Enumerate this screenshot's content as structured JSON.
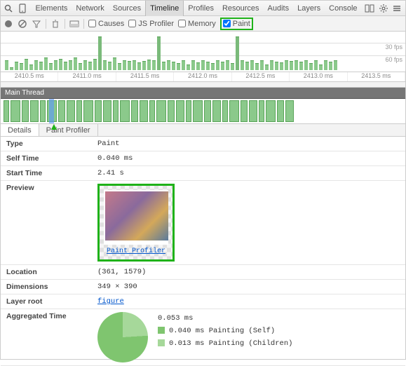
{
  "tabs": [
    "Elements",
    "Network",
    "Sources",
    "Timeline",
    "Profiles",
    "Resources",
    "Audits",
    "Layers",
    "Console"
  ],
  "toolbar": {
    "causes": "Causes",
    "jsprofiler": "JS Profiler",
    "memory": "Memory",
    "paint": "Paint"
  },
  "fps": {
    "l30": "30 fps",
    "l60": "60 fps"
  },
  "ruler": [
    "2410.5 ms",
    "2411.0 ms",
    "2411.5 ms",
    "2412.0 ms",
    "2412.5 ms",
    "2413.0 ms",
    "2413.5 ms"
  ],
  "thread_title": "Main Thread",
  "subtabs": {
    "details": "Details",
    "paintprofiler": "Paint Profiler"
  },
  "details": {
    "type_k": "Type",
    "type_v": "Paint",
    "self_k": "Self Time",
    "self_v": "0.040 ms",
    "start_k": "Start Time",
    "start_v": "2.41 s",
    "preview_k": "Preview",
    "preview_link": "Paint Profiler",
    "loc_k": "Location",
    "loc_v": "(361, 1579)",
    "dim_k": "Dimensions",
    "dim_v": "349 × 390",
    "layer_k": "Layer root",
    "layer_v": "figure",
    "agg_k": "Aggregated Time",
    "agg_total": "0.053 ms",
    "agg_self": "0.040 ms Painting (Self)",
    "agg_children": "0.013 ms Painting (Children)"
  },
  "chart_data": {
    "type": "pie",
    "title": "Aggregated Time",
    "series": [
      {
        "name": "Painting (Self)",
        "value": 0.04
      },
      {
        "name": "Painting (Children)",
        "value": 0.013
      }
    ],
    "total": 0.053,
    "unit": "ms"
  }
}
